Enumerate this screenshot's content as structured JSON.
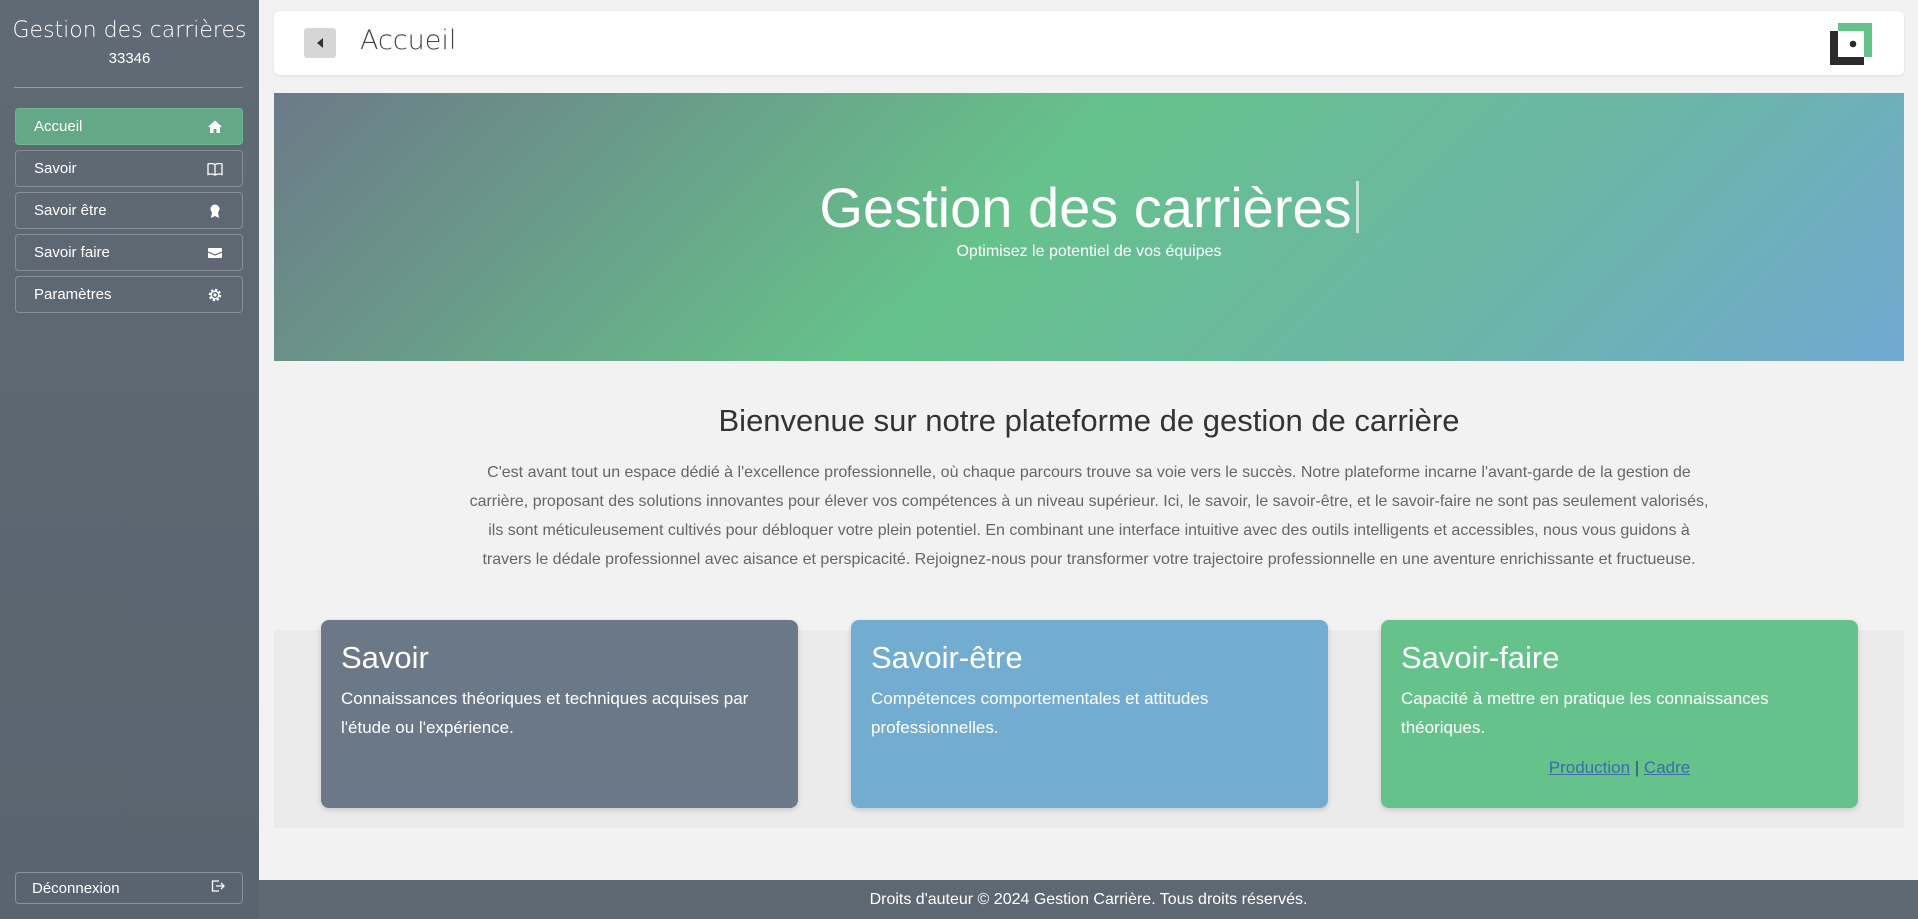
{
  "sidebar": {
    "app_title": "Gestion des carrières",
    "user_id": "33346",
    "items": [
      {
        "label": "Accueil",
        "icon": "home-icon"
      },
      {
        "label": "Savoir",
        "icon": "book-icon"
      },
      {
        "label": "Savoir être",
        "icon": "award-icon"
      },
      {
        "label": "Savoir faire",
        "icon": "briefcase-icon"
      },
      {
        "label": "Paramètres",
        "icon": "gear-icon"
      }
    ],
    "logout_label": "Déconnexion"
  },
  "topbar": {
    "title": "Accueil"
  },
  "hero": {
    "title": "Gestion des carrières",
    "subtitle": "Optimisez le potentiel de vos équipes"
  },
  "intro": {
    "title": "Bienvenue sur notre plateforme de gestion de carrière",
    "text": "C'est avant tout un espace dédié à l'excellence professionnelle, où chaque parcours trouve sa voie vers le succès. Notre plateforme incarne l'avant-garde de la gestion de carrière, proposant des solutions innovantes pour élever vos compétences à un niveau supérieur. Ici, le savoir, le savoir-être, et le savoir-faire ne sont pas seulement valorisés, ils sont méticuleusement cultivés pour débloquer votre plein potentiel. En combinant une interface intuitive avec des outils intelligents et accessibles, nous vous guidons à travers le dédale professionnel avec aisance et perspicacité. Rejoignez-nous pour transformer votre trajectoire professionnelle en une aventure enrichissante et fructueuse."
  },
  "cards": [
    {
      "title": "Savoir",
      "text": "Connaissances théoriques et techniques acquises par l'étude ou l'expérience.",
      "color": "#6b7888"
    },
    {
      "title": "Savoir-être",
      "text": "Compétences comportementales et attitudes professionnelles.",
      "color": "#72acd0"
    },
    {
      "title": "Savoir-faire",
      "text": "Capacité à mettre en pratique les connaissances théoriques.",
      "color": "#66c28b",
      "link1": "Production",
      "separator": "|",
      "link2": "Cadre"
    }
  ],
  "footer": {
    "text": "Droits d'auteur © 2024 Gestion Carrière. Tous droits réservés."
  },
  "colors": {
    "sidebar_bg": "#5e6872",
    "active_item": "#64a887",
    "accent_green": "#66c28b"
  }
}
